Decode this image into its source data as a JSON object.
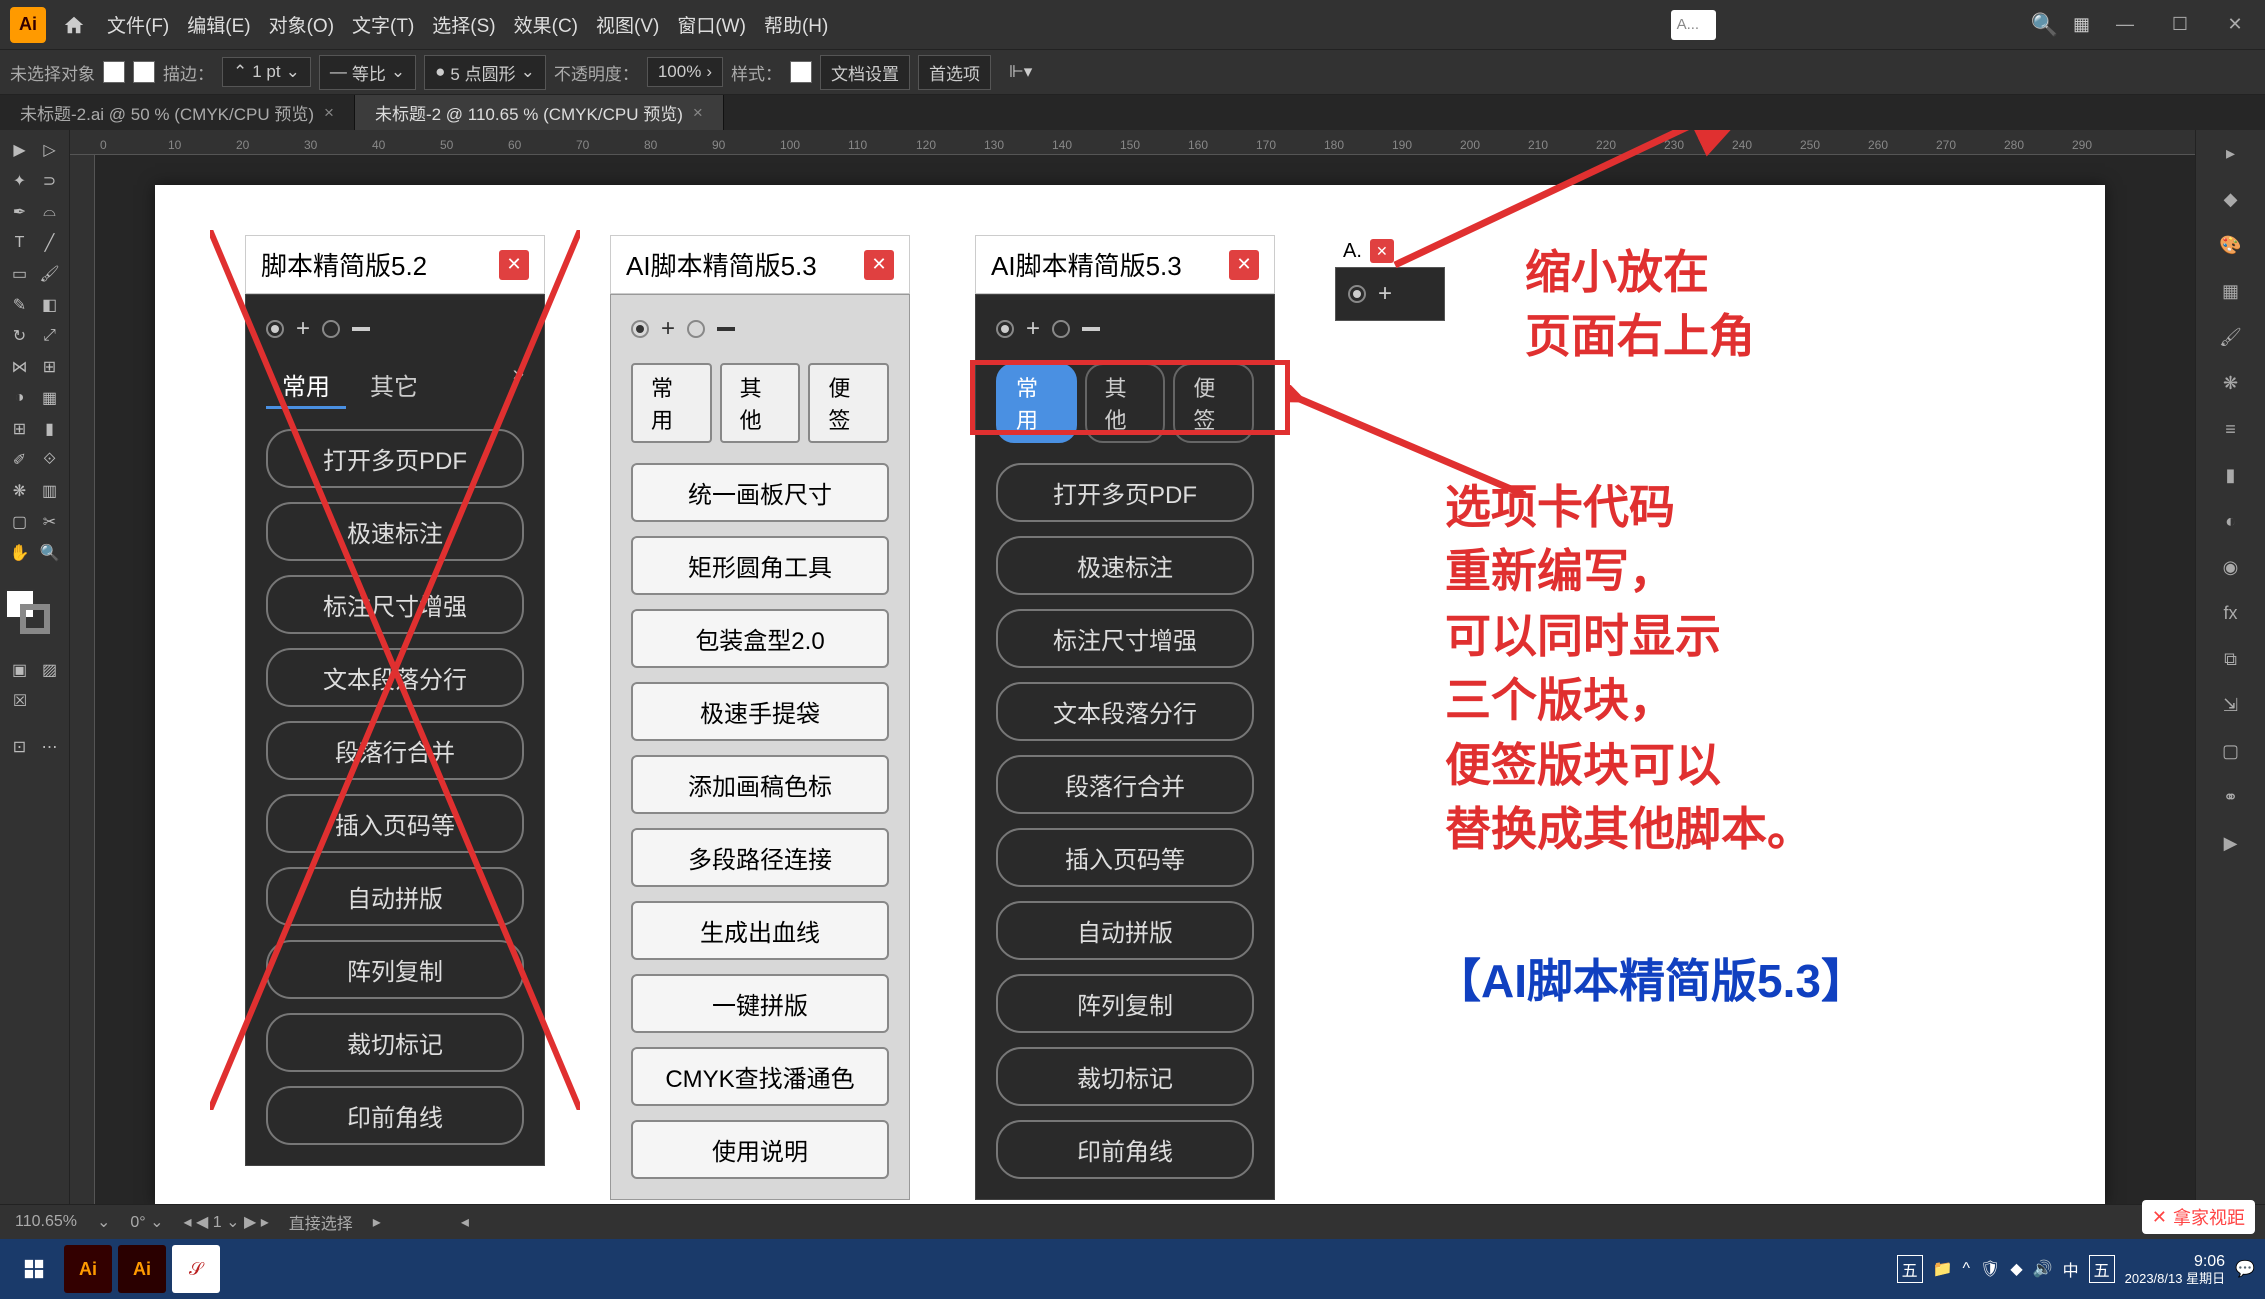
{
  "menubar": {
    "items": [
      "文件(F)",
      "编辑(E)",
      "对象(O)",
      "文字(T)",
      "选择(S)",
      "效果(C)",
      "视图(V)",
      "窗口(W)",
      "帮助(H)"
    ],
    "search_hint": "A..."
  },
  "propbar": {
    "no_selection": "未选择对象",
    "stroke_label": "描边：",
    "stroke_val": "1 pt",
    "uniform": "等比",
    "brush_val": "5 点圆形",
    "opacity_label": "不透明度：",
    "opacity_val": "100%",
    "style_label": "样式：",
    "doc_setup": "文档设置",
    "prefs": "首选项"
  },
  "tabs": {
    "t1": "未标题-2.ai @ 50 % (CMYK/CPU 预览)",
    "t2": "未标题-2 @ 110.65 % (CMYK/CPU 预览)"
  },
  "ruler_marks": [
    "0",
    "10",
    "20",
    "30",
    "40",
    "50",
    "60",
    "70",
    "80",
    "90",
    "100",
    "110",
    "120",
    "130",
    "140",
    "150",
    "160",
    "170",
    "180",
    "190",
    "200",
    "210",
    "220",
    "230",
    "240",
    "250",
    "260",
    "270",
    "280",
    "290"
  ],
  "panel52": {
    "title": "脚本精简版5.2",
    "tabs": [
      "常用",
      "其它"
    ],
    "buttons": [
      "打开多页PDF",
      "极速标注",
      "标注尺寸增强",
      "文本段落分行",
      "段落行合并",
      "插入页码等",
      "自动拼版",
      "阵列复制",
      "裁切标记",
      "印前角线"
    ]
  },
  "panel53_light": {
    "title": "AI脚本精简版5.3",
    "tabs": [
      "常用",
      "其他",
      "便签"
    ],
    "buttons": [
      "统一画板尺寸",
      "矩形圆角工具",
      "包装盒型2.0",
      "极速手提袋",
      "添加画稿色标",
      "多段路径连接",
      "生成出血线",
      "一键拼版",
      "CMYK查找潘通色",
      "使用说明"
    ]
  },
  "panel53_dark": {
    "title": "AI脚本精简版5.3",
    "tabs": [
      "常用",
      "其他",
      "便签"
    ],
    "buttons": [
      "打开多页PDF",
      "极速标注",
      "标注尺寸增强",
      "文本段落分行",
      "段落行合并",
      "插入页码等",
      "自动拼版",
      "阵列复制",
      "裁切标记",
      "印前角线"
    ]
  },
  "mini_panel": {
    "title": "A."
  },
  "annotations": {
    "top_right_1": "缩小放在",
    "top_right_2": "页面右上角",
    "mid_1": "选项卡代码",
    "mid_2": "重新编写，",
    "mid_3": "可以同时显示",
    "mid_4": "三个版块，",
    "mid_5": "便签版块可以",
    "mid_6": "替换成其他脚本。",
    "blue": "【AI脚本精简版5.3】"
  },
  "statusbar": {
    "zoom": "110.65%",
    "nav": "1",
    "tool": "直接选择"
  },
  "taskbar": {
    "time": "9:06",
    "date": "2023/8/13 星期日",
    "ime_label": "中",
    "input_label": "五"
  },
  "watermark": "拿家视距"
}
